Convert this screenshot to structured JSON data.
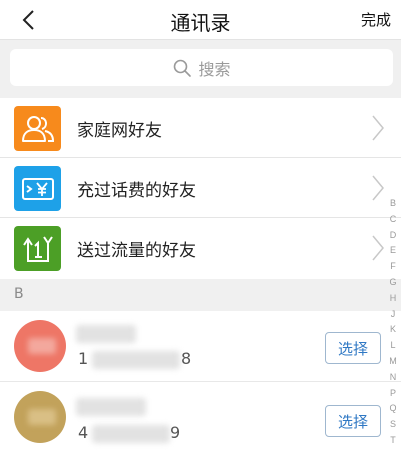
{
  "navbar": {
    "title": "通讯录",
    "done_label": "完成"
  },
  "search": {
    "placeholder": "搜索"
  },
  "menu": [
    {
      "label": "家庭网好友",
      "icon": "people-icon",
      "color": "#F78A1C"
    },
    {
      "label": "充过话费的好友",
      "icon": "yen-card-icon",
      "color": "#1EA1E8"
    },
    {
      "label": "送过流量的好友",
      "icon": "data-transfer-icon",
      "color": "#4C9F26"
    }
  ],
  "section_header": "B",
  "contacts": [
    {
      "name_partial": "",
      "phone_start": "1",
      "phone_end": "8",
      "avatar_color": "#EE7666",
      "select_label": "选择"
    },
    {
      "name_partial": "",
      "phone_start": "4",
      "phone_end": "9",
      "avatar_color": "#C2A25B",
      "select_label": "选择"
    }
  ],
  "alphabet_index": [
    "B",
    "C",
    "D",
    "E",
    "F",
    "G",
    "H",
    "J",
    "K",
    "L",
    "M",
    "N",
    "P",
    "Q",
    "S",
    "T"
  ]
}
